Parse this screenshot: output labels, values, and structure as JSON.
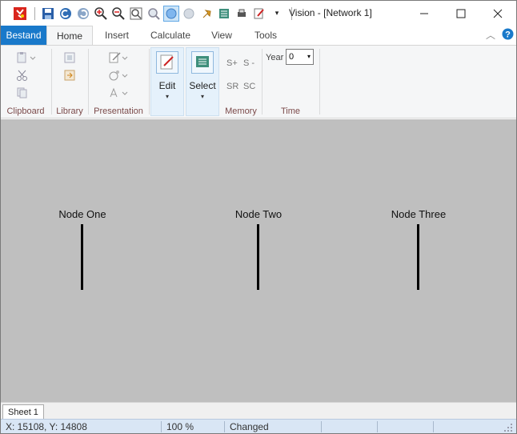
{
  "window": {
    "title": "Vision - [Network 1]",
    "controls": {
      "minimize": "─",
      "maximize": "☐",
      "close": "✕"
    }
  },
  "quick_access": {
    "icons": [
      "app-logo-icon",
      "save-icon",
      "undo-icon",
      "redo-icon",
      "zoom-in-icon",
      "zoom-out-icon",
      "zoom-fit-icon",
      "zoom-window-icon",
      "node-mode-icon",
      "circle-icon",
      "pin-icon",
      "list-icon",
      "print-icon",
      "edit-icon"
    ],
    "more": "▾"
  },
  "tabs": {
    "file": "Bestand",
    "home": "Home",
    "insert": "Insert",
    "calculate": "Calculate",
    "view": "View",
    "tools": "Tools",
    "collapse": "︿",
    "help": "?"
  },
  "ribbon": {
    "clipboard": "Clipboard",
    "library": "Library",
    "presentation": "Presentation",
    "edit": "Edit",
    "select": "Select",
    "memory": "Memory",
    "time": "Time",
    "memory_buttons": {
      "s_plus": "S+",
      "s_minus": "S -",
      "sr": "SR",
      "sc": "SC"
    },
    "year_label": "Year",
    "year_value": "0",
    "dropdown_arrow": "▾"
  },
  "nodes": [
    {
      "label": "Node One"
    },
    {
      "label": "Node Two"
    },
    {
      "label": "Node Three"
    }
  ],
  "sheets": {
    "active": "Sheet 1"
  },
  "status": {
    "coords": "X: 15108, Y: 14808",
    "zoom": "100 %",
    "state": "Changed"
  }
}
